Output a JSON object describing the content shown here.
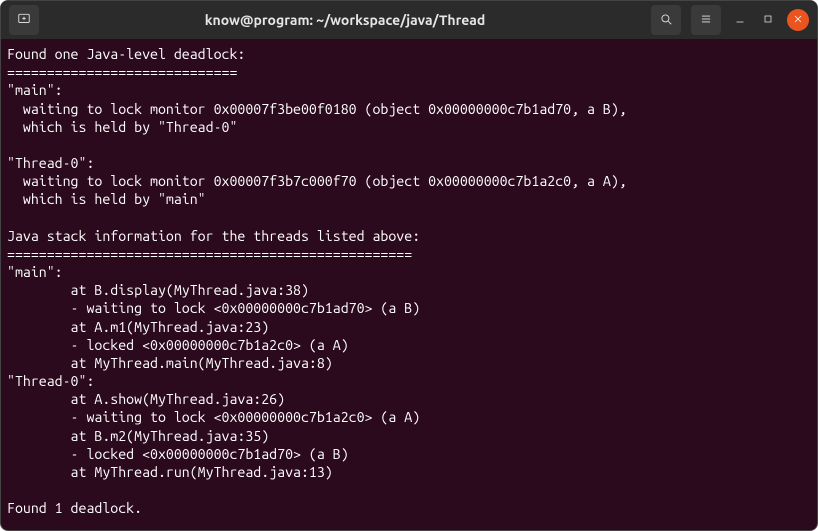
{
  "window": {
    "title": "know@program: ~/workspace/java/Thread"
  },
  "terminal": {
    "lines": [
      "Found one Java-level deadlock:",
      "=============================",
      "\"main\":",
      "  waiting to lock monitor 0x00007f3be00f0180 (object 0x00000000c7b1ad70, a B),",
      "  which is held by \"Thread-0\"",
      "",
      "\"Thread-0\":",
      "  waiting to lock monitor 0x00007f3b7c000f70 (object 0x00000000c7b1a2c0, a A),",
      "  which is held by \"main\"",
      "",
      "Java stack information for the threads listed above:",
      "===================================================",
      "\"main\":",
      "        at B.display(MyThread.java:38)",
      "        - waiting to lock <0x00000000c7b1ad70> (a B)",
      "        at A.m1(MyThread.java:23)",
      "        - locked <0x00000000c7b1a2c0> (a A)",
      "        at MyThread.main(MyThread.java:8)",
      "\"Thread-0\":",
      "        at A.show(MyThread.java:26)",
      "        - waiting to lock <0x00000000c7b1a2c0> (a A)",
      "        at B.m2(MyThread.java:35)",
      "        - locked <0x00000000c7b1ad70> (a B)",
      "        at MyThread.run(MyThread.java:13)",
      "",
      "Found 1 deadlock."
    ]
  }
}
